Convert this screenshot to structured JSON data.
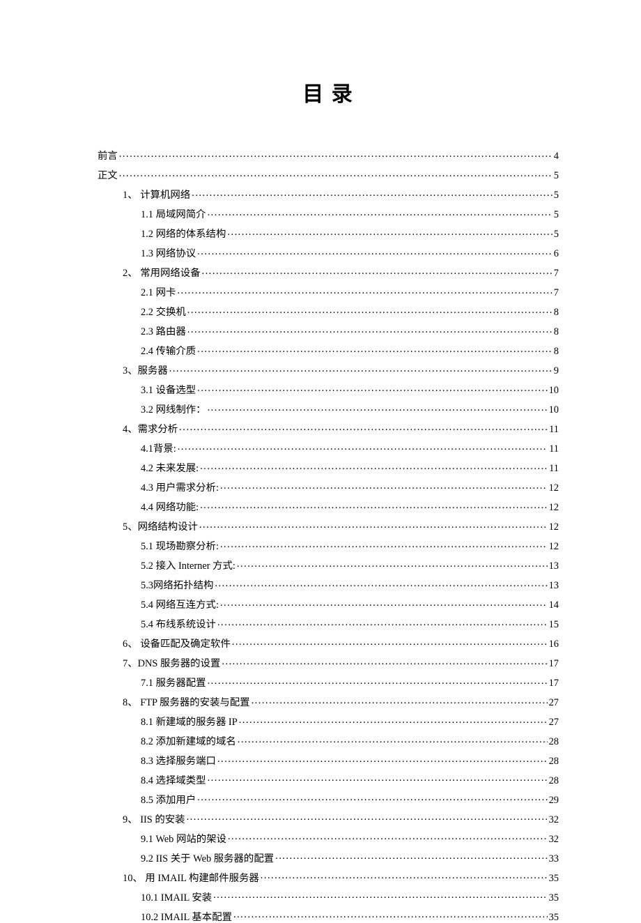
{
  "title": "目 录",
  "toc": [
    {
      "level": 0,
      "num": "",
      "label": "前言",
      "page": "4"
    },
    {
      "level": 0,
      "num": "",
      "label": "正文",
      "page": "5"
    },
    {
      "level": 1,
      "num": "1、",
      "label": " 计算机网络",
      "page": "5"
    },
    {
      "level": 2,
      "num": "1.1",
      "label": " 局域网简介",
      "page": "5"
    },
    {
      "level": 2,
      "num": "1.2",
      "label": " 网络的体系结构",
      "page": "5"
    },
    {
      "level": 2,
      "num": "1.3",
      "label": " 网络协议",
      "page": "6"
    },
    {
      "level": 1,
      "num": "2、",
      "label": " 常用网络设备",
      "page": "7"
    },
    {
      "level": 2,
      "num": "2.1",
      "label": " 网卡",
      "page": "7"
    },
    {
      "level": 2,
      "num": "2.2",
      "label": " 交换机",
      "page": "8"
    },
    {
      "level": 2,
      "num": "2.3",
      "label": " 路由器",
      "page": "8"
    },
    {
      "level": 2,
      "num": "2.4",
      "label": " 传输介质",
      "page": "8"
    },
    {
      "level": 1,
      "num": "3、",
      "label": "服务器",
      "page": "9"
    },
    {
      "level": 2,
      "num": "3.1",
      "label": " 设备选型",
      "page": "10"
    },
    {
      "level": 2,
      "num": "3.2",
      "label": " 网线制作：",
      "page": "10"
    },
    {
      "level": 1,
      "num": "4、",
      "label": "需求分析",
      "page": "11"
    },
    {
      "level": 2,
      "num": "4.1",
      "label": "背景:",
      "page": "11"
    },
    {
      "level": 2,
      "num": "4.2",
      "label": " 未来发展:",
      "page": "11"
    },
    {
      "level": 2,
      "num": "4.3",
      "label": " 用户需求分析:",
      "page": "12"
    },
    {
      "level": 2,
      "num": "4.4",
      "label": " 网络功能:",
      "page": "12"
    },
    {
      "level": 1,
      "num": "5、",
      "label": "网络结构设计",
      "page": "12"
    },
    {
      "level": 2,
      "num": "5.1",
      "label": " 现场勘察分析:",
      "page": "12"
    },
    {
      "level": 2,
      "num": "5.2",
      "label": " 接入 Interner 方式:",
      "page": "13"
    },
    {
      "level": 2,
      "num": "5.3",
      "label": "网络拓扑结构",
      "page": "13"
    },
    {
      "level": 2,
      "num": "5.4",
      "label": " 网络互连方式:",
      "page": "14"
    },
    {
      "level": 2,
      "num": "5.4",
      "label": " 布线系统设计",
      "page": "15"
    },
    {
      "level": 1,
      "num": "6、",
      "label": " 设备匹配及确定软件",
      "page": "16"
    },
    {
      "level": 1,
      "num": "7、",
      "label": "DNS 服务器的设置",
      "page": "17"
    },
    {
      "level": 2,
      "num": "7.1",
      "label": " 服务器配置",
      "page": "17"
    },
    {
      "level": 1,
      "num": "8、",
      "label": " FTP 服务器的安装与配置",
      "page": "27"
    },
    {
      "level": 2,
      "num": "8.1",
      "label": " 新建域的服务器 IP",
      "page": "27"
    },
    {
      "level": 2,
      "num": "8.2",
      "label": " 添加新建域的域名",
      "page": "28"
    },
    {
      "level": 2,
      "num": "8.3",
      "label": "  选择服务端口",
      "page": "28"
    },
    {
      "level": 2,
      "num": "8.4",
      "label": "  选择域类型",
      "page": "28"
    },
    {
      "level": 2,
      "num": "8.5",
      "label": "  添加用户",
      "page": "29"
    },
    {
      "level": 1,
      "num": "9、",
      "label": " IIS 的安装",
      "page": "32"
    },
    {
      "level": 2,
      "num": "9.1",
      "label": " Web 网站的架设",
      "page": "32"
    },
    {
      "level": 2,
      "num": "",
      "label": "  9.2 IIS 关于 Web 服务器的配置",
      "page": "33"
    },
    {
      "level": 1,
      "num": "10、",
      "label": " 用 IMAIL 构建邮件服务器",
      "page": "35"
    },
    {
      "level": 2,
      "num": "10.1",
      "label": "   IMAIL 安装",
      "page": "35"
    },
    {
      "level": 2,
      "num": "10.2",
      "label": " IMAIL 基本配置",
      "page": "35"
    }
  ]
}
